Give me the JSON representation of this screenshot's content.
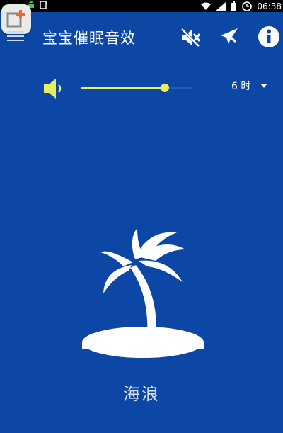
{
  "statusbar": {
    "time": "06:38"
  },
  "header": {
    "title": "宝宝催眠音效"
  },
  "volume": {
    "level": 0.75
  },
  "timer": {
    "value": "6 时"
  },
  "scene": {
    "label": "海浪",
    "icon": "palm-island-icon"
  },
  "colors": {
    "background": "#0d47a6",
    "accent": "#e8ef5b"
  }
}
